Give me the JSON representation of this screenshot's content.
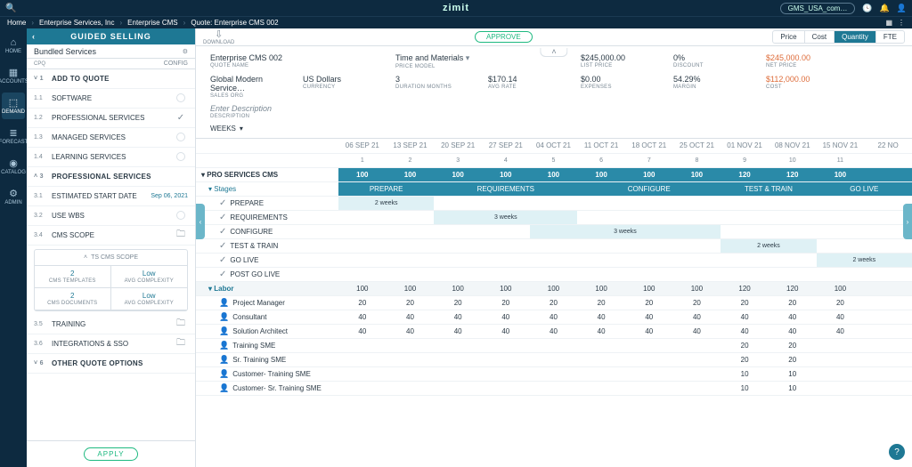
{
  "top": {
    "brand": "zimit",
    "org": "GMS_USA_com…"
  },
  "crumb": [
    "Home",
    "Enterprise Services, Inc",
    "Enterprise CMS",
    "Quote: Enterprise CMS 002"
  ],
  "rail": [
    {
      "icon": "⌂",
      "label": "HOME"
    },
    {
      "icon": "▦",
      "label": "ACCOUNTS"
    },
    {
      "icon": "⬚",
      "label": "DEMAND"
    },
    {
      "icon": "≣",
      "label": "FORECAST"
    },
    {
      "icon": "◉",
      "label": "CATALOG"
    },
    {
      "icon": "⚙",
      "label": "ADMIN"
    }
  ],
  "sidebar": {
    "title": "GUIDED SELLING",
    "bundle": "Bundled Services",
    "cpq": "CPQ",
    "cfg": "CONFIG",
    "sec1": {
      "num": "1",
      "label": "ADD TO QUOTE"
    },
    "r11": {
      "num": "1.1",
      "label": "SOFTWARE"
    },
    "r12": {
      "num": "1.2",
      "label": "PROFESSIONAL SERVICES"
    },
    "r13": {
      "num": "1.3",
      "label": "MANAGED SERVICES"
    },
    "r14": {
      "num": "1.4",
      "label": "LEARNING SERVICES"
    },
    "sec3": {
      "num": "3",
      "label": "PROFESSIONAL SERVICES"
    },
    "r31": {
      "num": "3.1",
      "label": "ESTIMATED START DATE",
      "val": "Sep 06, 2021"
    },
    "r32": {
      "num": "3.2",
      "label": "USE WBS"
    },
    "r34": {
      "num": "3.4",
      "label": "CMS SCOPE"
    },
    "scope": {
      "title": "TS CMS SCOPE",
      "c": [
        {
          "v": "2",
          "t": "CMS TEMPLATES"
        },
        {
          "v": "Low",
          "t": "AVG COMPLEXITY"
        },
        {
          "v": "2",
          "t": "CMS DOCUMENTS"
        },
        {
          "v": "Low",
          "t": "AVG COMPLEXITY"
        }
      ]
    },
    "r35": {
      "num": "3.5",
      "label": "TRAINING"
    },
    "r36": {
      "num": "3.6",
      "label": "INTEGRATIONS & SSO"
    },
    "sec6": {
      "num": "6",
      "label": "OTHER QUOTE OPTIONS"
    },
    "apply": "APPLY"
  },
  "tb": {
    "download": "DOWNLOAD",
    "approve": "APPROVE",
    "seg": [
      "Price",
      "Cost",
      "Quantity",
      "FTE"
    ]
  },
  "info": {
    "quote_name": {
      "v": "Enterprise CMS 002",
      "t": "QUOTE NAME"
    },
    "price_model": {
      "v": "Time and Materials",
      "t": "PRICE MODEL"
    },
    "list": {
      "v": "$245,000.00",
      "t": "LIST PRICE"
    },
    "disc": {
      "v": "0%",
      "t": "DISCOUNT"
    },
    "net": {
      "v": "$245,000.00",
      "t": "NET PRICE"
    },
    "org": {
      "v": "Global Modern Service…",
      "t": "SALES ORG"
    },
    "cur": {
      "v": "US Dollars",
      "t": "CURRENCY"
    },
    "dur": {
      "v": "3",
      "t": "DURATION MONTHS"
    },
    "rate": {
      "v": "$170.14",
      "t": "AVG RATE"
    },
    "exp": {
      "v": "$0.00",
      "t": "EXPENSES"
    },
    "margin": {
      "v": "54.29%",
      "t": "MARGIN"
    },
    "cost": {
      "v": "$112,000.00",
      "t": "COST"
    },
    "desc": {
      "v": "Enter Description",
      "t": "DESCRIPTION"
    },
    "weeks": "WEEKS"
  },
  "chart_data": {
    "type": "table",
    "dates": [
      "06 SEP 21",
      "13 SEP 21",
      "20 SEP 21",
      "27 SEP 21",
      "04 OCT 21",
      "11 OCT 21",
      "18 OCT 21",
      "25 OCT 21",
      "01 NOV 21",
      "08 NOV 21",
      "15 NOV 21",
      "22 NO"
    ],
    "nums": [
      "1",
      "2",
      "3",
      "4",
      "5",
      "6",
      "7",
      "8",
      "9",
      "10",
      "11",
      ""
    ],
    "group": {
      "name": "PRO SERVICES CMS",
      "vals": [
        "100",
        "100",
        "100",
        "100",
        "100",
        "100",
        "100",
        "100",
        "120",
        "120",
        "100",
        ""
      ]
    },
    "stages_label": "Stages",
    "stage_headers": [
      {
        "label": "PREPARE",
        "span": 2
      },
      {
        "label": "REQUIREMENTS",
        "span": 3
      },
      {
        "label": "CONFIGURE",
        "span": 3
      },
      {
        "label": "TEST & TRAIN",
        "span": 2
      },
      {
        "label": "GO LIVE",
        "span": 2
      }
    ],
    "gantt": [
      {
        "name": "PREPARE",
        "start": 0,
        "span": 2,
        "text": "2 weeks"
      },
      {
        "name": "REQUIREMENTS",
        "start": 2,
        "span": 3,
        "text": "3 weeks"
      },
      {
        "name": "CONFIGURE",
        "start": 4,
        "span": 4,
        "text": "3 weeks"
      },
      {
        "name": "TEST & TRAIN",
        "start": 8,
        "span": 2,
        "text": "2 weeks"
      },
      {
        "name": "GO LIVE",
        "start": 10,
        "span": 2,
        "text": "2 weeks"
      },
      {
        "name": "POST GO LIVE",
        "start": 12,
        "span": 0,
        "text": ""
      }
    ],
    "labor_label": "Labor",
    "labor_hdr": [
      "100",
      "100",
      "100",
      "100",
      "100",
      "100",
      "100",
      "100",
      "120",
      "120",
      "100",
      ""
    ],
    "labor": [
      {
        "name": "Project Manager",
        "vals": [
          "20",
          "20",
          "20",
          "20",
          "20",
          "20",
          "20",
          "20",
          "20",
          "20",
          "20",
          ""
        ]
      },
      {
        "name": "Consultant",
        "vals": [
          "40",
          "40",
          "40",
          "40",
          "40",
          "40",
          "40",
          "40",
          "40",
          "40",
          "40",
          ""
        ]
      },
      {
        "name": "Solution Architect",
        "vals": [
          "40",
          "40",
          "40",
          "40",
          "40",
          "40",
          "40",
          "40",
          "40",
          "40",
          "40",
          ""
        ]
      },
      {
        "name": "Training SME",
        "vals": [
          "",
          "",
          "",
          "",
          "",
          "",
          "",
          "",
          "20",
          "20",
          "",
          ""
        ]
      },
      {
        "name": "Sr. Training SME",
        "vals": [
          "",
          "",
          "",
          "",
          "",
          "",
          "",
          "",
          "20",
          "20",
          "",
          ""
        ]
      },
      {
        "name": "Customer- Training SME",
        "vals": [
          "",
          "",
          "",
          "",
          "",
          "",
          "",
          "",
          "10",
          "10",
          "",
          ""
        ]
      },
      {
        "name": "Customer- Sr. Training SME",
        "vals": [
          "",
          "",
          "",
          "",
          "",
          "",
          "",
          "",
          "10",
          "10",
          "",
          ""
        ]
      }
    ]
  }
}
